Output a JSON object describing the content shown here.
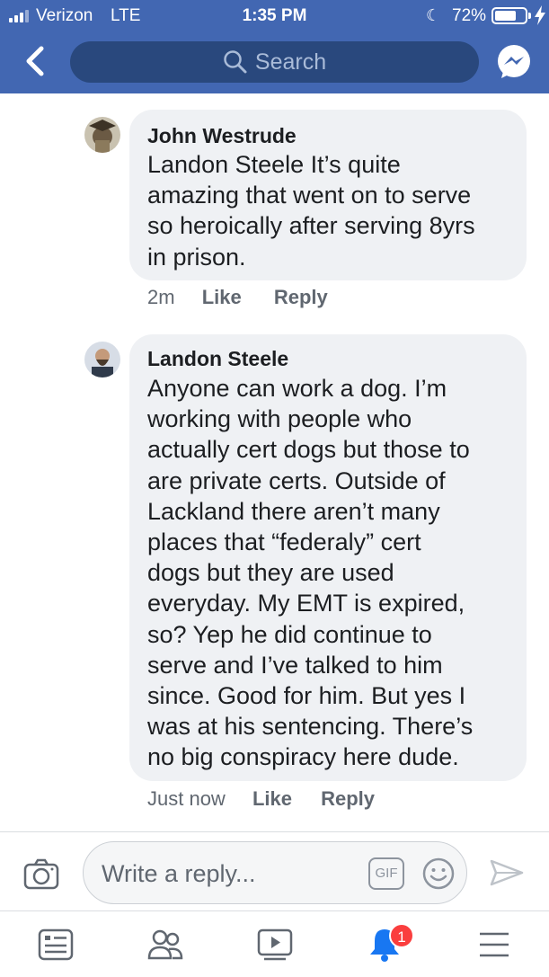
{
  "status_bar": {
    "carrier": "Verizon",
    "network": "LTE",
    "time": "1:35 PM",
    "battery_percent": "72%",
    "battery_level": 0.72
  },
  "nav": {
    "search_placeholder": "Search",
    "back_icon": "chevron-left-icon",
    "messenger_icon": "messenger-icon"
  },
  "comments": [
    {
      "author": "John Westrude",
      "lines": [
        "Landon Steele It’s quite",
        "amazing that went on to serve",
        "so heroically after serving 8yrs",
        "in prison."
      ],
      "time": "2m",
      "like": "Like",
      "reply": "Reply"
    },
    {
      "author": "Landon Steele",
      "lines": [
        "Anyone can work a dog. I’m",
        "working with people who",
        "actually cert dogs but those to",
        "are private certs. Outside of",
        "Lackland there aren’t many",
        "places that “federaly” cert",
        "dogs but they are used",
        "everyday. My EMT is expired,",
        "so? Yep he did continue to",
        "serve and I’ve talked to him",
        "since. Good for him. But yes I",
        "was at his sentencing. There’s",
        "no big conspiracy here dude."
      ],
      "time": "Just now",
      "like": "Like",
      "reply": "Reply"
    }
  ],
  "reply_bar": {
    "placeholder": "Write a reply...",
    "gif_label": "GIF"
  },
  "bottom_nav": {
    "notification_count": "1"
  },
  "colors": {
    "header": "#4267b2",
    "search_field": "#29487d",
    "bubble": "#eff1f4",
    "badge": "#fa3e3e",
    "notifications_active": "#1877f2"
  }
}
